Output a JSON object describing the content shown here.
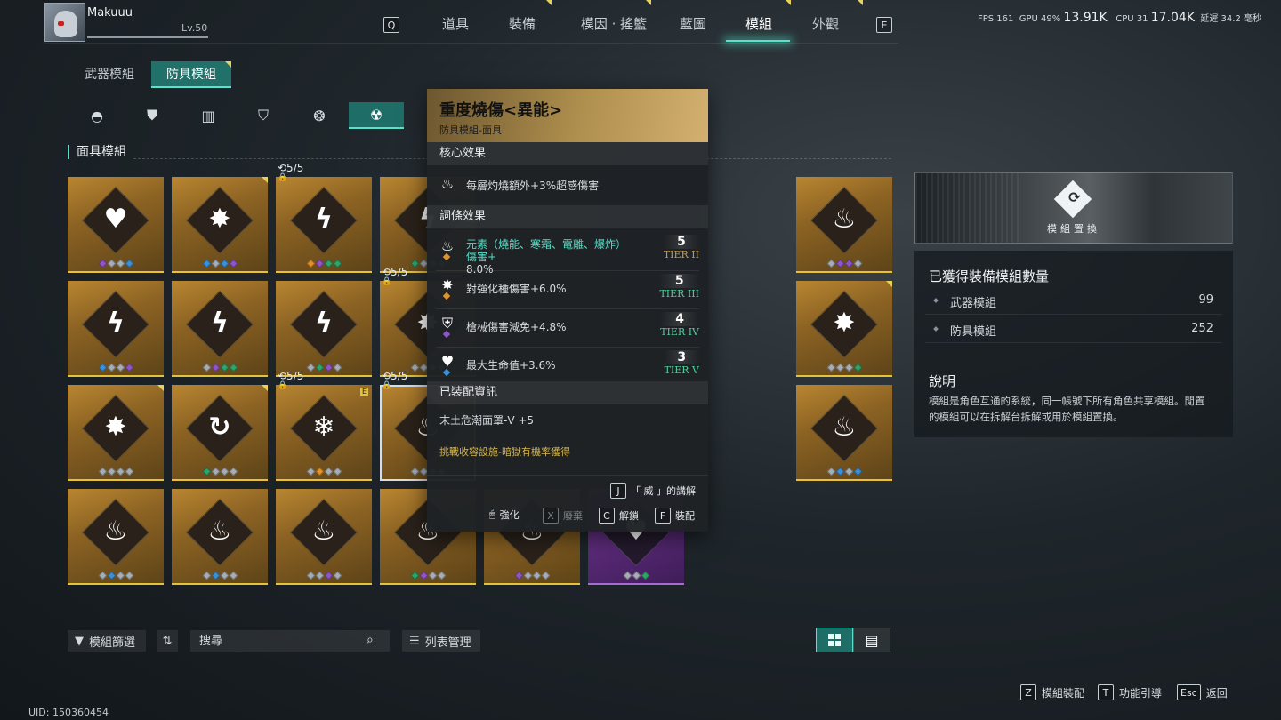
{
  "player": {
    "name": "Makuuu",
    "level": "Lv.50",
    "uid": "UID: 150360454"
  },
  "nav": {
    "key_left": "Q",
    "key_right": "E",
    "tabs": [
      "道具",
      "裝備",
      "模因 · 搖籃",
      "藍圖",
      "模組",
      "外觀"
    ],
    "active_tab": "模組"
  },
  "stats": {
    "fps_label": "FPS",
    "fps": "161",
    "gpu_label": "GPU",
    "gpu": "49%",
    "mem1": "13.91K",
    "cpu_label": "CPU",
    "cpu": "31",
    "mem2": "17.04K",
    "latency_label": "延遲",
    "latency": "34.2 毫秒"
  },
  "subtabs": {
    "weapon": "武器模組",
    "armor": "防具模組"
  },
  "section_title": "面具模組",
  "cards": [
    {
      "glyph": "♥",
      "dots": [
        "purple",
        "grey",
        "grey",
        "blue"
      ]
    },
    {
      "glyph": "✸",
      "dots": [
        "blue",
        "grey",
        "blue",
        "purple"
      ],
      "corner": true
    },
    {
      "glyph": "ϟ",
      "dots": [
        "orange",
        "purple",
        "green",
        "green"
      ],
      "count": "5/5"
    },
    {
      "glyph": "ϟ",
      "dots": [
        "green",
        "grey",
        "grey",
        "grey"
      ]
    },
    null,
    null,
    null,
    {
      "glyph": "♨",
      "dots": [
        "grey",
        "purple",
        "purple",
        "grey"
      ]
    },
    {
      "glyph": "♨",
      "dots": [
        "blue",
        "grey",
        "purple",
        "grey"
      ]
    },
    {
      "glyph": "ϟ",
      "dots": [
        "blue",
        "grey",
        "grey",
        "purple"
      ]
    },
    {
      "glyph": "ϟ",
      "dots": [
        "grey",
        "purple",
        "green",
        "green"
      ]
    },
    {
      "glyph": "ϟ",
      "dots": [
        "grey",
        "green",
        "purple",
        "grey"
      ]
    },
    {
      "glyph": "✸",
      "dots": [
        "grey",
        "grey",
        "grey",
        "grey"
      ],
      "count": "5/5"
    },
    null,
    null,
    null,
    {
      "glyph": "✸",
      "dots": [
        "grey",
        "grey",
        "grey",
        "green"
      ],
      "corner": true
    },
    {
      "glyph": "✸",
      "dots": [
        "green",
        "grey",
        "green",
        "green"
      ],
      "corner": true
    },
    {
      "glyph": "✸",
      "dots": [
        "grey",
        "grey",
        "grey",
        "grey"
      ],
      "corner": true
    },
    {
      "glyph": "↻",
      "dots": [
        "green",
        "grey",
        "grey",
        "grey"
      ],
      "corner": true
    },
    {
      "glyph": "❄",
      "dots": [
        "grey",
        "orange",
        "grey",
        "grey"
      ],
      "count": "5/5",
      "ebadge": "E"
    },
    {
      "glyph": "♨",
      "dots": [
        "grey",
        "grey",
        "grey",
        "grey"
      ],
      "count": "5/5",
      "selected": true
    },
    null,
    null,
    null,
    {
      "glyph": "♨",
      "dots": [
        "grey",
        "blue",
        "grey",
        "blue"
      ]
    },
    {
      "glyph": "♨",
      "dots": [
        "purple",
        "grey",
        "green",
        "green"
      ]
    },
    {
      "glyph": "♨",
      "dots": [
        "grey",
        "blue",
        "grey",
        "grey"
      ]
    },
    {
      "glyph": "♨",
      "dots": [
        "grey",
        "blue",
        "grey",
        "grey"
      ]
    },
    {
      "glyph": "♨",
      "dots": [
        "grey",
        "grey",
        "purple",
        "grey"
      ]
    },
    {
      "glyph": "♨",
      "dots": [
        "green",
        "purple",
        "grey",
        "grey"
      ]
    },
    {
      "glyph": "♨",
      "dots": [
        "purple",
        "grey",
        "grey",
        "grey"
      ]
    },
    {
      "glyph": "♥",
      "dots": [
        "grey",
        "grey",
        "green"
      ],
      "purple": true
    },
    null,
    null
  ],
  "tooltip": {
    "title": "重度燒傷<異能>",
    "subtitle": "防具模組-面具",
    "core_header": "核心效果",
    "core_text": "每層灼燒額外+3%超感傷害",
    "affix_header": "詞條效果",
    "affixes": [
      {
        "line1": "元素（燒能、寒霜、電離、爆炸）傷害+",
        "line2": "8.0%",
        "level": "5",
        "tier": "TIER II",
        "mini": "orange"
      },
      {
        "line1": "對強化種傷害+6.0%",
        "line2": "",
        "level": "5",
        "tier": "TIER III",
        "mini": "orange"
      },
      {
        "line1": "槍械傷害減免+4.8%",
        "line2": "",
        "level": "4",
        "tier": "TIER IV",
        "mini": "purple"
      },
      {
        "line1": "最大生命值+3.6%",
        "line2": "",
        "level": "3",
        "tier": "TIER V",
        "mini": "blue"
      }
    ],
    "equip_header": "已裝配資訊",
    "equip_name": "末土危潮面罩-V +5",
    "source": "挑戰收容設施-暗獄有機率獲得",
    "lecture": {
      "key": "J",
      "label": "「 威 」的講解"
    },
    "actions": [
      {
        "key": "🖱",
        "label": "強化"
      },
      {
        "key": "X",
        "label": "廢棄"
      },
      {
        "key": "C",
        "label": "解鎖"
      },
      {
        "key": "F",
        "label": "裝配"
      }
    ]
  },
  "right_panel": {
    "swap_label": "模組置換",
    "owned_title": "已獲得裝備模組數量",
    "rows": [
      {
        "label": "武器模組",
        "value": "99"
      },
      {
        "label": "防具模組",
        "value": "252"
      }
    ],
    "desc_title": "說明",
    "desc_text": "模組是角色互通的系統，同一帳號下所有角色共享模組。閒置的模組可以在拆解台拆解或用於模組置換。"
  },
  "toolbar": {
    "filter_label": "模組篩選",
    "search_placeholder": "搜尋",
    "list_mgmt_label": "列表管理"
  },
  "hints": [
    {
      "key": "Z",
      "label": "模組裝配"
    },
    {
      "key": "T",
      "label": "功能引導"
    },
    {
      "key": "Esc",
      "label": "返回"
    }
  ]
}
